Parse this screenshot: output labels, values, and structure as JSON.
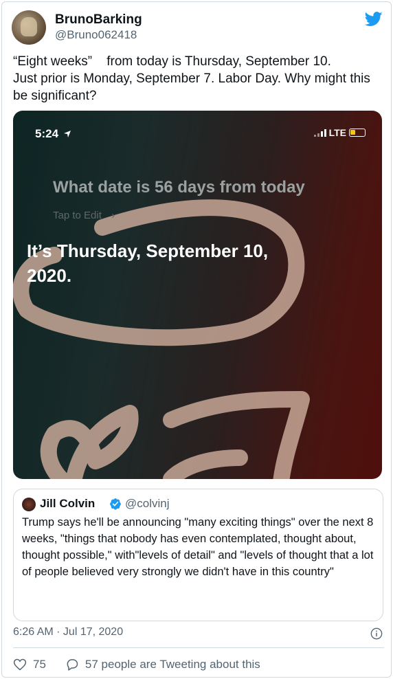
{
  "author": {
    "display_name": "BrunoBarking",
    "handle": "@Bruno062418"
  },
  "tweet": {
    "text": "“Eight weeks”    from today is Thursday, September 10.\nJust prior is Monday, September 7. Labor Day. Why might this be significant?"
  },
  "media": {
    "status_time": "5:24",
    "network": "LTE",
    "siri_question": "What date is 56 days from today",
    "tap_to_edit": "Tap to Edit",
    "siri_answer": "It’s Thursday, September 10, 2020."
  },
  "quote": {
    "name": "Jill Colvin",
    "handle": "@colvinj",
    "text": "Trump says he'll be announcing \"many exciting things\" over the next 8 weeks, \"things that nobody has even contemplated, thought about, thought possible,\" with\"levels of detail\" and \"levels of thought that a lot of people believed very strongly we didn't have in this country\""
  },
  "timestamp": "6:26 AM · Jul 17, 2020",
  "actions": {
    "like_count": "75",
    "tweeting_text": "57 people are Tweeting about this"
  },
  "colors": {
    "twitter_blue": "#1d9bf0",
    "secondary_text": "#536471",
    "border": "#cfd9de"
  },
  "icons": [
    "twitter-bird-icon",
    "location-arrow-icon",
    "signal-icon",
    "battery-icon",
    "verified-badge-icon",
    "info-icon",
    "heart-icon",
    "reply-icon"
  ]
}
